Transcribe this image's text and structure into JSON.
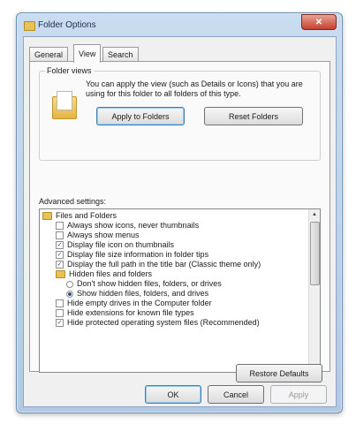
{
  "window": {
    "title": "Folder Options",
    "close_glyph": "✕"
  },
  "tabs": [
    {
      "label": "General",
      "active": false
    },
    {
      "label": "View",
      "active": true
    },
    {
      "label": "Search",
      "active": false
    }
  ],
  "folder_views": {
    "group_label": "Folder views",
    "description": "You can apply the view (such as Details or Icons) that you are using for this folder to all folders of this type.",
    "apply_button": "Apply to Folders",
    "reset_button": "Reset Folders"
  },
  "advanced": {
    "label": "Advanced settings:",
    "items": [
      {
        "kind": "folder",
        "label": "Files and Folders"
      },
      {
        "kind": "checkbox",
        "checked": false,
        "label": "Always show icons, never thumbnails"
      },
      {
        "kind": "checkbox",
        "checked": false,
        "label": "Always show menus"
      },
      {
        "kind": "checkbox",
        "checked": true,
        "label": "Display file icon on thumbnails"
      },
      {
        "kind": "checkbox",
        "checked": true,
        "label": "Display file size information in folder tips"
      },
      {
        "kind": "checkbox",
        "checked": true,
        "label": "Display the full path in the title bar (Classic theme only)"
      },
      {
        "kind": "folder",
        "label": "Hidden files and folders"
      },
      {
        "kind": "radio",
        "checked": false,
        "label": "Don't show hidden files, folders, or drives"
      },
      {
        "kind": "radio",
        "checked": true,
        "label": "Show hidden files, folders, and drives"
      },
      {
        "kind": "checkbox",
        "checked": false,
        "label": "Hide empty drives in the Computer folder"
      },
      {
        "kind": "checkbox",
        "checked": false,
        "label": "Hide extensions for known file types"
      },
      {
        "kind": "checkbox",
        "checked": true,
        "label": "Hide protected operating system files (Recommended)"
      }
    ],
    "restore_button": "Restore Defaults"
  },
  "footer": {
    "ok": "OK",
    "cancel": "Cancel",
    "apply": "Apply"
  },
  "scroll": {
    "up_glyph": "▲",
    "down_glyph": "▼"
  }
}
